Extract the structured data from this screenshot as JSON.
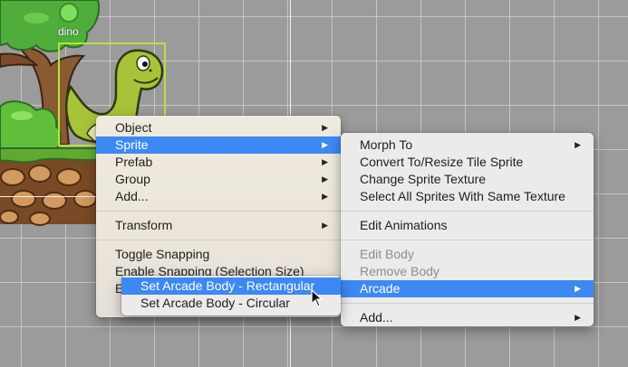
{
  "scene": {
    "sprite_label": "dino"
  },
  "context_menu": {
    "items": [
      {
        "label": "Object"
      },
      {
        "label": "Sprite"
      },
      {
        "label": "Prefab"
      },
      {
        "label": "Group"
      },
      {
        "label": "Add..."
      },
      {
        "label": "Transform"
      },
      {
        "label": "Toggle Snapping"
      },
      {
        "label": "Enable Snapping (Selection Size)"
      },
      {
        "label": "E"
      }
    ]
  },
  "sprite_submenu": {
    "items": [
      {
        "label": "Morph To"
      },
      {
        "label": "Convert To/Resize Tile Sprite"
      },
      {
        "label": "Change Sprite Texture"
      },
      {
        "label": "Select All Sprites With Same Texture"
      },
      {
        "label": "Edit Animations"
      },
      {
        "label": "Edit Body"
      },
      {
        "label": "Remove Body"
      },
      {
        "label": "Arcade"
      },
      {
        "label": "Add..."
      }
    ]
  },
  "arcade_submenu": {
    "items": [
      {
        "label": "Set Arcade Body - Rectangular"
      },
      {
        "label": "Set Arcade Body - Circular"
      }
    ]
  },
  "colors": {
    "highlight": "#3d89f3",
    "selection_outline": "#b6e23c",
    "disabled_text": "#8d8d8d"
  }
}
